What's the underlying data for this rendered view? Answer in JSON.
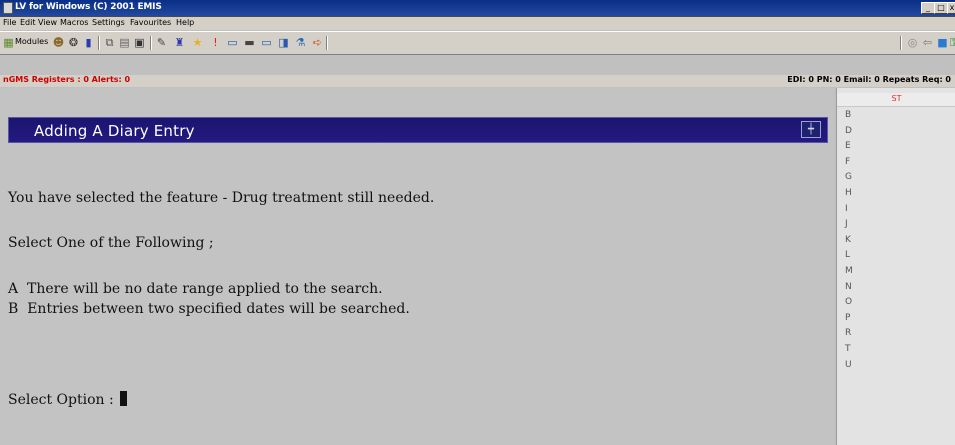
{
  "window": {
    "title": "LV for Windows (C) 2001 EMIS"
  },
  "menu": [
    "File",
    "Edit",
    "View",
    "Macros",
    "Settings",
    "Favourites",
    "Help"
  ],
  "toolbar": {
    "modules_label": "Modules"
  },
  "status": {
    "left": "nGMS Registers : 0  Alerts: 0",
    "right": "EDI: 0  PN: 0  Email: 0  Repeats Req: 0"
  },
  "dialog": {
    "title": "Adding A Diary Entry",
    "selected_line": "You have selected the feature - Drug treatment still needed.",
    "prompt": "Select One of the Following ;",
    "options": [
      {
        "key": "A",
        "text": "There will be no date range applied to the search."
      },
      {
        "key": "B",
        "text": "Entries between two specified dates will be searched."
      }
    ],
    "input_label": "Select Option : "
  },
  "panel": {
    "header": "ST",
    "letters": [
      "B",
      "D",
      "E",
      "F",
      "G",
      "H",
      "I",
      "J",
      "K",
      "L",
      "M",
      "N",
      "O",
      "P",
      "R",
      "T",
      "U"
    ]
  },
  "colors": {
    "banner": "#1b1570",
    "alert_red": "#d00000",
    "panel_header_red": "#e03030"
  }
}
